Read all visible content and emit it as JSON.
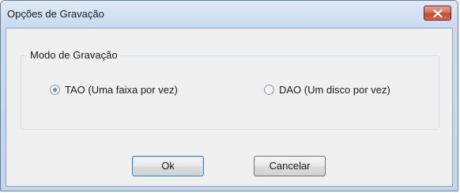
{
  "window": {
    "title": "Opções de Gravação"
  },
  "group": {
    "legend": "Modo de Gravação",
    "options": [
      {
        "label": "TAO (Uma faixa por vez)",
        "checked": true
      },
      {
        "label": "DAO (Um disco por vez)",
        "checked": false
      }
    ]
  },
  "buttons": {
    "ok": "Ok",
    "cancel": "Cancelar"
  },
  "icons": {
    "close": "close-icon",
    "radio": "radio-icon"
  },
  "colors": {
    "close_button": "#c44a32",
    "titlebar": "#c9dbf0"
  }
}
